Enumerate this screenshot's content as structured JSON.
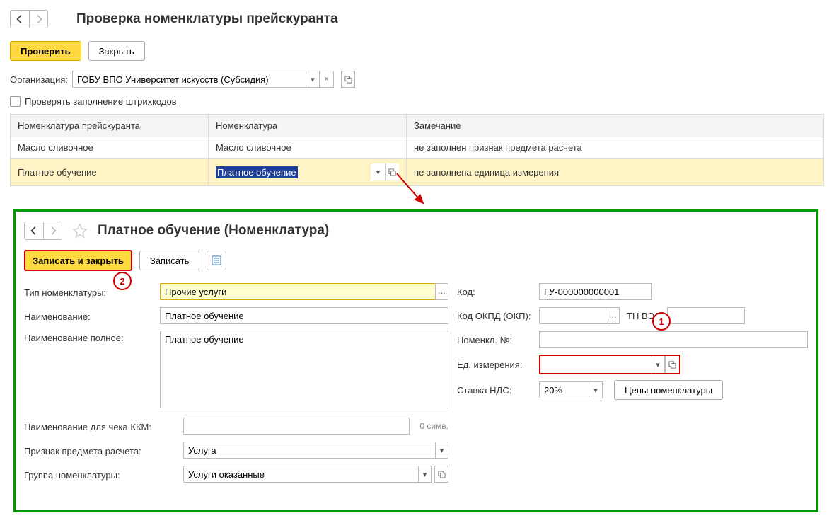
{
  "top": {
    "title": "Проверка номенклатуры прейскуранта",
    "check_btn": "Проверить",
    "close_btn": "Закрыть",
    "org_label": "Организация:",
    "org_value": "ГОБУ ВПО Университет искусств (Субсидия)",
    "barcode_check": "Проверять заполнение штрихкодов"
  },
  "table": {
    "headers": [
      "Номенклатура прейскуранта",
      "Номенклатура",
      "Замечание"
    ],
    "rows": [
      {
        "c0": "Масло сливочное",
        "c1": "Масло сливочное",
        "c2": "не заполнен признак предмета расчета"
      },
      {
        "c0": "Платное обучение",
        "c1": "Платное обучение",
        "c2": "не заполнена единица измерения"
      }
    ]
  },
  "sub": {
    "title": "Платное обучение (Номенклатура)",
    "save_close_btn": "Записать и закрыть",
    "save_btn": "Записать",
    "left": {
      "type_label": "Тип номенклатуры:",
      "type_value": "Прочие услуги",
      "name_label": "Наименование:",
      "name_value": "Платное обучение",
      "full_name_label": "Наименование полное:",
      "full_name_value": "Платное обучение",
      "kkm_label": "Наименование для чека ККМ:",
      "kkm_value": "",
      "kkm_count": "0 симв.",
      "subject_label": "Признак предмета расчета:",
      "subject_value": "Услуга",
      "group_label": "Группа номенклатуры:",
      "group_value": "Услуги оказанные"
    },
    "right": {
      "code_label": "Код:",
      "code_value": "ГУ-000000000001",
      "okpd_label": "Код ОКПД (ОКП):",
      "okpd_value": "",
      "tnved_label": "ТН ВЭД:",
      "tnved_value": "",
      "nomno_label": "Номенкл. №:",
      "nomno_value": "",
      "unit_label": "Ед. измерения:",
      "unit_value": "",
      "vat_label": "Ставка НДС:",
      "vat_value": "20%",
      "prices_btn": "Цены номенклатуры"
    }
  },
  "markers": {
    "m1": "1",
    "m2": "2"
  }
}
